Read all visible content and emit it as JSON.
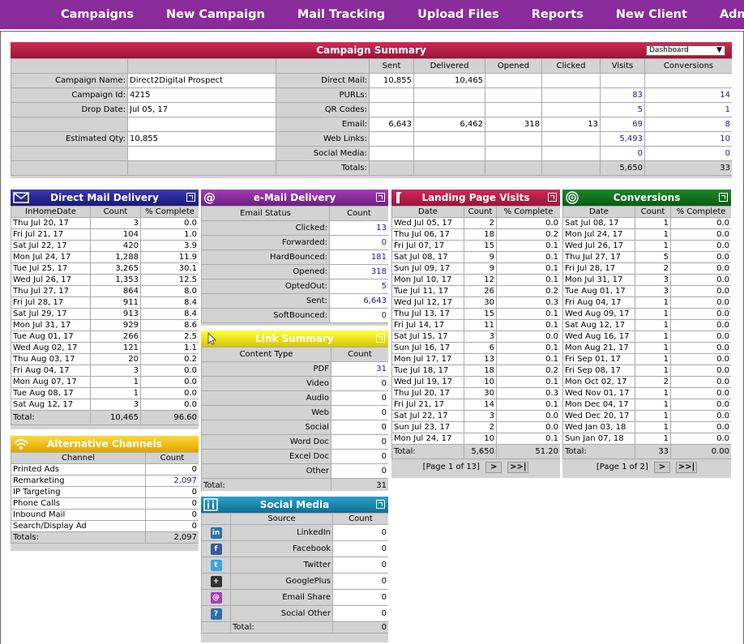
{
  "nav": [
    "Campaigns",
    "New Campaign",
    "Mail Tracking",
    "Upload Files",
    "Reports",
    "New Client",
    "Admin"
  ],
  "summary": {
    "title": "Campaign Summary",
    "dropdown": "Dashboard",
    "cols": [
      "Sent",
      "Delivered",
      "Opened",
      "Clicked",
      "Visits",
      "Conversions"
    ],
    "left": [
      {
        "label": "Campaign Name:",
        "value": "Direct2Digital Prospect"
      },
      {
        "label": "Campaign Id:",
        "value": "4215"
      },
      {
        "label": "Drop Date:",
        "value": "Jul 05, 17"
      },
      {
        "label": "",
        "value": ""
      },
      {
        "label": "Estimated Qty:",
        "value": "10,855"
      },
      {
        "label": "",
        "value": ""
      },
      {
        "label": "",
        "value": ""
      }
    ],
    "rows": [
      {
        "label": "Direct Mail:",
        "cells": [
          "10,855",
          "10,465",
          "",
          "",
          "",
          ""
        ]
      },
      {
        "label": "PURLs:",
        "cells": [
          "",
          "",
          "",
          "",
          "83",
          "14"
        ]
      },
      {
        "label": "QR Codes:",
        "cells": [
          "",
          "",
          "",
          "",
          "5",
          "1"
        ]
      },
      {
        "label": "Email:",
        "cells": [
          "6,643",
          "6,462",
          "318",
          "13",
          "69",
          "8"
        ]
      },
      {
        "label": "Web Links:",
        "cells": [
          "",
          "",
          "",
          "",
          "5,493",
          "10"
        ]
      },
      {
        "label": "Social Media:",
        "cells": [
          "",
          "",
          "",
          "",
          "0",
          "0"
        ]
      },
      {
        "label": "Totals:",
        "cells": [
          "",
          "",
          "",
          "",
          "5,650",
          "33"
        ]
      }
    ]
  },
  "direct_mail": {
    "title": "Direct Mail Delivery",
    "cols": [
      "InHomeDate",
      "Count",
      "% Complete"
    ],
    "rows": [
      [
        "Thu Jul 20, 17",
        "3",
        "0.0"
      ],
      [
        "Fri Jul 21, 17",
        "104",
        "1.0"
      ],
      [
        "Sat Jul 22, 17",
        "420",
        "3.9"
      ],
      [
        "Mon Jul 24, 17",
        "1,288",
        "11.9"
      ],
      [
        "Tue Jul 25, 17",
        "3,265",
        "30.1"
      ],
      [
        "Wed Jul 26, 17",
        "1,353",
        "12.5"
      ],
      [
        "Thu Jul 27, 17",
        "864",
        "8.0"
      ],
      [
        "Fri Jul 28, 17",
        "911",
        "8.4"
      ],
      [
        "Sat Jul 29, 17",
        "913",
        "8.4"
      ],
      [
        "Mon Jul 31, 17",
        "929",
        "8.6"
      ],
      [
        "Tue Aug 01, 17",
        "266",
        "2.5"
      ],
      [
        "Wed Aug 02, 17",
        "121",
        "1.1"
      ],
      [
        "Thu Aug 03, 17",
        "20",
        "0.2"
      ],
      [
        "Fri Aug 04, 17",
        "3",
        "0.0"
      ],
      [
        "Mon Aug 07, 17",
        "1",
        "0.0"
      ],
      [
        "Tue Aug 08, 17",
        "1",
        "0.0"
      ],
      [
        "Sat Aug 12, 17",
        "3",
        "0.0"
      ]
    ],
    "total": [
      "Total:",
      "10,465",
      "96.60"
    ]
  },
  "alt": {
    "title": "Alternative Channels",
    "cols": [
      "Channel",
      "Count"
    ],
    "rows": [
      [
        "Printed Ads",
        "0"
      ],
      [
        "Remarketing",
        "2,097"
      ],
      [
        "IP Targeting",
        "0"
      ],
      [
        "Phone Calls",
        "0"
      ],
      [
        "Inbound Mail",
        "0"
      ],
      [
        "Search/Display Ad",
        "0"
      ]
    ],
    "total": [
      "Totals:",
      "2,097"
    ]
  },
  "email": {
    "title": "e-Mail Delivery",
    "cols": [
      "Email Status",
      "Count"
    ],
    "rows": [
      [
        "Clicked:",
        "13"
      ],
      [
        "Forwarded:",
        "0"
      ],
      [
        "HardBounced:",
        "181"
      ],
      [
        "Opened:",
        "318"
      ],
      [
        "OptedOut:",
        "5"
      ],
      [
        "Sent:",
        "6,643"
      ],
      [
        "SoftBounced:",
        "0"
      ]
    ]
  },
  "links": {
    "title": "Link Summary",
    "cols": [
      "Content Type",
      "Count"
    ],
    "rows": [
      [
        "PDF",
        "31"
      ],
      [
        "Video",
        "0"
      ],
      [
        "Audio",
        "0"
      ],
      [
        "Web",
        "0"
      ],
      [
        "Social",
        "0"
      ],
      [
        "Word Doc",
        "0"
      ],
      [
        "Excel Doc",
        "0"
      ],
      [
        "Other",
        "0"
      ]
    ],
    "total": [
      "Total:",
      "31"
    ]
  },
  "social": {
    "title": "Social Media",
    "cols": [
      "Source",
      "Count"
    ],
    "rows": [
      {
        "icon": "linkedin-icon",
        "glyph": "in",
        "color": "#2a6fb0",
        "name": "LinkedIn",
        "count": "0"
      },
      {
        "icon": "facebook-icon",
        "glyph": "f",
        "color": "#3b5998",
        "name": "Facebook",
        "count": "0"
      },
      {
        "icon": "twitter-icon",
        "glyph": "t",
        "color": "#3ea3dc",
        "name": "Twitter",
        "count": "0"
      },
      {
        "icon": "googleplus-icon",
        "glyph": "+",
        "color": "#333333",
        "name": "GooglePlus",
        "count": "0"
      },
      {
        "icon": "email-share-icon",
        "glyph": "@",
        "color": "#a23fb5",
        "name": "Email Share",
        "count": "0"
      },
      {
        "icon": "other-icon",
        "glyph": "?",
        "color": "#2a6fb0",
        "name": "Social Other",
        "count": "0"
      }
    ],
    "total": [
      "Total:",
      "0"
    ]
  },
  "landing": {
    "title": "Landing Page Visits",
    "cols": [
      "Date",
      "Count",
      "% Complete"
    ],
    "rows": [
      [
        "Wed Jul 05, 17",
        "2",
        "0.0"
      ],
      [
        "Thu Jul 06, 17",
        "18",
        "0.2"
      ],
      [
        "Fri Jul 07, 17",
        "15",
        "0.1"
      ],
      [
        "Sat Jul 08, 17",
        "9",
        "0.1"
      ],
      [
        "Sun Jul 09, 17",
        "9",
        "0.1"
      ],
      [
        "Mon Jul 10, 17",
        "12",
        "0.1"
      ],
      [
        "Tue Jul 11, 17",
        "26",
        "0.2"
      ],
      [
        "Wed Jul 12, 17",
        "30",
        "0.3"
      ],
      [
        "Thu Jul 13, 17",
        "15",
        "0.1"
      ],
      [
        "Fri Jul 14, 17",
        "11",
        "0.1"
      ],
      [
        "Sat Jul 15, 17",
        "3",
        "0.0"
      ],
      [
        "Sun Jul 16, 17",
        "6",
        "0.1"
      ],
      [
        "Mon Jul 17, 17",
        "13",
        "0.1"
      ],
      [
        "Tue Jul 18, 17",
        "18",
        "0.2"
      ],
      [
        "Wed Jul 19, 17",
        "10",
        "0.1"
      ],
      [
        "Thu Jul 20, 17",
        "30",
        "0.3"
      ],
      [
        "Fri Jul 21, 17",
        "14",
        "0.1"
      ],
      [
        "Sat Jul 22, 17",
        "3",
        "0.0"
      ],
      [
        "Sun Jul 23, 17",
        "2",
        "0.0"
      ],
      [
        "Mon Jul 24, 17",
        "10",
        "0.1"
      ]
    ],
    "total": [
      "Total:",
      "5,650",
      "51.20"
    ],
    "pager": "[Page 1 of 13]"
  },
  "conversions": {
    "title": "Conversions",
    "cols": [
      "Date",
      "Count",
      "% Complete"
    ],
    "rows": [
      [
        "Sat Jul 08, 17",
        "1",
        "0.0"
      ],
      [
        "Mon Jul 24, 17",
        "1",
        "0.0"
      ],
      [
        "Wed Jul 26, 17",
        "1",
        "0.0"
      ],
      [
        "Thu Jul 27, 17",
        "5",
        "0.0"
      ],
      [
        "Fri Jul 28, 17",
        "2",
        "0.0"
      ],
      [
        "Mon Jul 31, 17",
        "3",
        "0.0"
      ],
      [
        "Tue Aug 01, 17",
        "3",
        "0.0"
      ],
      [
        "Fri Aug 04, 17",
        "1",
        "0.0"
      ],
      [
        "Wed Aug 09, 17",
        "1",
        "0.0"
      ],
      [
        "Sat Aug 12, 17",
        "1",
        "0.0"
      ],
      [
        "Wed Aug 16, 17",
        "1",
        "0.0"
      ],
      [
        "Mon Aug 21, 17",
        "1",
        "0.0"
      ],
      [
        "Fri Sep 01, 17",
        "1",
        "0.0"
      ],
      [
        "Fri Sep 08, 17",
        "1",
        "0.0"
      ],
      [
        "Mon Oct 02, 17",
        "2",
        "0.0"
      ],
      [
        "Wed Nov 01, 17",
        "1",
        "0.0"
      ],
      [
        "Mon Dec 04, 17",
        "1",
        "0.0"
      ],
      [
        "Wed Dec 20, 17",
        "1",
        "0.0"
      ],
      [
        "Wed Jan 03, 18",
        "1",
        "0.0"
      ],
      [
        "Sun Jan 07, 18",
        "1",
        "0.0"
      ]
    ],
    "total": [
      "Total:",
      "33",
      "0.00"
    ],
    "pager": "[Page 1 of 2]"
  },
  "pager_next": ">",
  "pager_last": ">>|"
}
